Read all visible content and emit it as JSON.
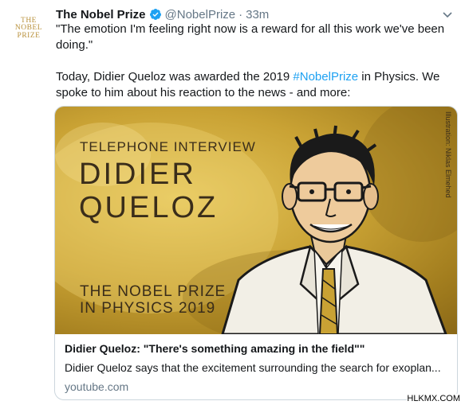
{
  "avatar": {
    "line1": "THE",
    "line2": "NOBEL",
    "line3": "PRIZE"
  },
  "header": {
    "display_name": "The Nobel Prize",
    "handle": "@NobelPrize",
    "separator": "·",
    "time": "33m"
  },
  "tweet": {
    "quote": "\"The emotion I'm feeling right now is a reward for all this work we've been doing.\"",
    "para2_before": "Today, Didier Queloz was awarded the 2019 ",
    "hashtag": "#NobelPrize",
    "para2_after": " in Physics. We spoke to him about his reaction to the news - and more:"
  },
  "card": {
    "image": {
      "subtitle": "TELEPHONE INTERVIEW",
      "name_line1": "DIDIER",
      "name_line2": "QUELOZ",
      "prize_line1": "THE NOBEL PRIZE",
      "prize_line2": "IN PHYSICS 2019",
      "credit": "Illustration: Niklas Elmehed"
    },
    "title": "Didier Queloz: \"There's something amazing in the field\"\"",
    "description": "Didier Queloz says that the excitement surrounding the search for exoplan...",
    "domain": "youtube.com"
  },
  "watermark": "HLKMX.COM",
  "colors": {
    "accent": "#1da1f2",
    "gold": "#c9a234",
    "muted": "#657786"
  }
}
